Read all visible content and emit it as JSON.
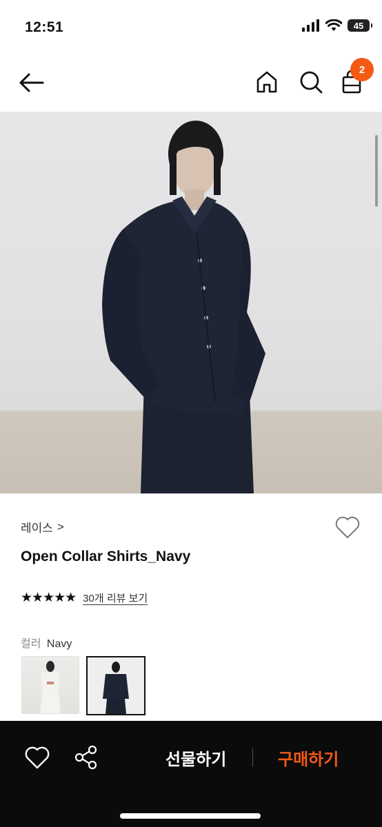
{
  "status_bar": {
    "time": "12:51",
    "battery": "45"
  },
  "nav": {
    "cart_count": "2"
  },
  "product": {
    "brand": "레이스",
    "brand_chevron": ">",
    "name": "Open Collar Shirts_Navy",
    "rating_stars": "★★★★★",
    "review_link": "30개 리뷰 보기",
    "color_label": "컬러",
    "color_value": "Navy",
    "swatches": [
      "ivory-set",
      "navy-set"
    ]
  },
  "actions": {
    "gift": "선물하기",
    "buy": "구매하기"
  },
  "colors": {
    "accent": "#f45a14",
    "bottom_bar": "#0b0b0b"
  }
}
